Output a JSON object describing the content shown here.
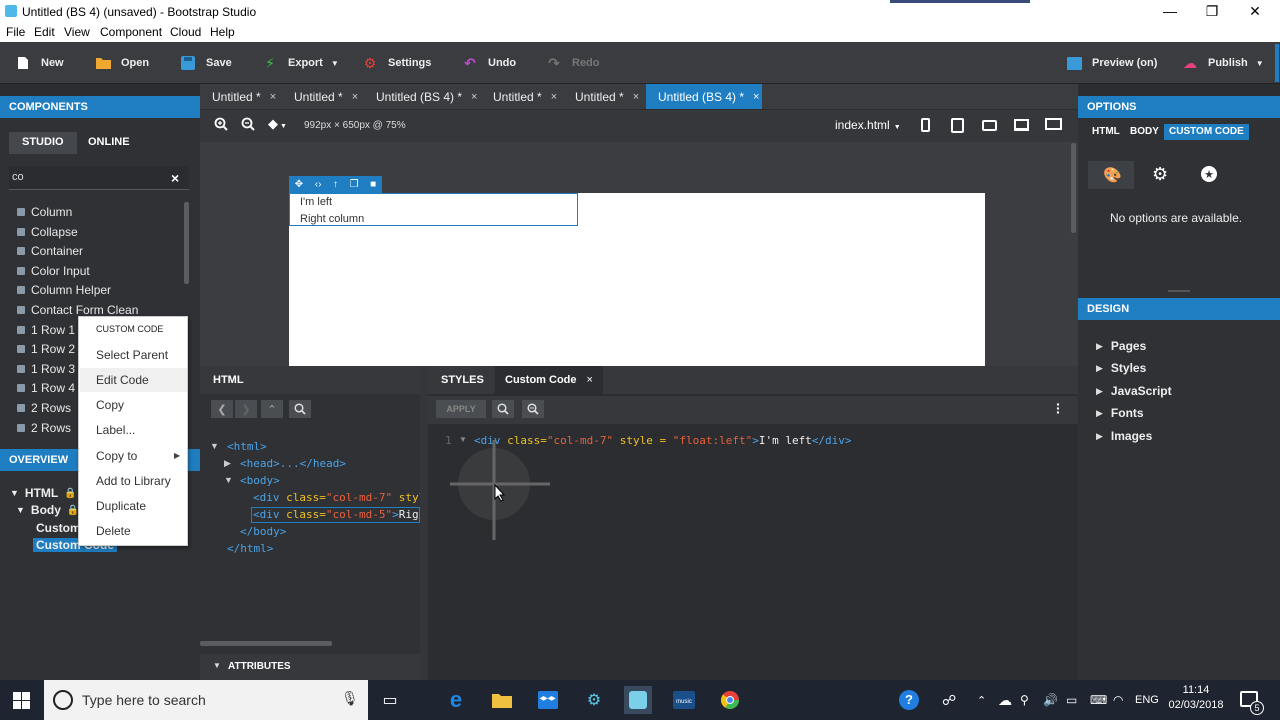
{
  "window": {
    "title": "Untitled (BS 4) (unsaved) - Bootstrap Studio",
    "controls": [
      "—",
      "❐",
      "✕"
    ]
  },
  "menubar": [
    "File",
    "Edit",
    "View",
    "Component",
    "Cloud",
    "Help"
  ],
  "toolbar": {
    "new": "New",
    "open": "Open",
    "save": "Save",
    "export": "Export",
    "settings": "Settings",
    "undo": "Undo",
    "redo": "Redo",
    "preview": "Preview (on)",
    "publish": "Publish"
  },
  "components": {
    "header": "COMPONENTS",
    "tab_studio": "STUDIO",
    "tab_online": "ONLINE",
    "search_value": "co",
    "clear": "×",
    "items": [
      "Column",
      "Collapse",
      "Container",
      "Color Input",
      "Column Helper",
      "Contact Form Clean",
      "1 Row 1",
      "1 Row 2",
      "1 Row 3",
      "1 Row 4",
      "2 Rows",
      "2 Rows"
    ]
  },
  "overview": {
    "header": "OVERVIEW",
    "html": "HTML",
    "body": "Body",
    "child1": "Custom",
    "child2": "Custom Code"
  },
  "doc_tabs": [
    {
      "label": "Untitled *"
    },
    {
      "label": "Untitled *"
    },
    {
      "label": "Untitled (BS 4) *"
    },
    {
      "label": "Untitled *"
    },
    {
      "label": "Untitled *"
    },
    {
      "label": "Untitled (BS 4) *"
    }
  ],
  "canvas_bar": {
    "size": "992px × 650px @ 75%",
    "page": "index.html"
  },
  "canvas": {
    "text1": "I'm left",
    "text2": "Right column"
  },
  "html_panel": {
    "header": "HTML",
    "lines": {
      "html_open": "<html>",
      "head": "<head>...</head>",
      "body_open": "<body>",
      "div1_tag": "<div",
      "div1_attr": "class=",
      "div1_val": "\"col-md-7\"",
      "div1_attr2": "style=",
      "div2_tag": "<div",
      "div2_attr": "class=",
      "div2_val": "\"col-md-5\"",
      "div2_close": ">",
      "div2_text": "Right c",
      "body_close": "</body>",
      "html_close": "</html>"
    },
    "attributes": "ATTRIBUTES"
  },
  "code_panel": {
    "tab_styles": "STYLES",
    "tab_custom": "Custom Code",
    "apply": "APPLY",
    "line_num": "1",
    "code_tag": "<div",
    "code_attr1": "class=",
    "code_val1": "\"col-md-7\"",
    "code_attr2": "style =",
    "code_val2": "\"float:left\"",
    "code_gt": ">",
    "code_text": "I'm left",
    "code_close": "</div>"
  },
  "options": {
    "header": "OPTIONS",
    "tabs": [
      "HTML",
      "BODY",
      "CUSTOM CODE"
    ],
    "empty": "No options are available."
  },
  "design": {
    "header": "DESIGN",
    "items": [
      "Pages",
      "Styles",
      "JavaScript",
      "Fonts",
      "Images"
    ]
  },
  "context_menu": {
    "header": "CUSTOM CODE",
    "items": [
      "Select Parent",
      "Edit Code",
      "Copy",
      "Label...",
      "Copy to",
      "Add to Library",
      "Duplicate",
      "Delete"
    ]
  },
  "taskbar": {
    "search_placeholder": "Type here to search",
    "lang": "ENG",
    "time": "11:14",
    "date": "02/03/2018",
    "notif": "5"
  },
  "colors": {
    "accent": "#1f7ec2",
    "panel": "#2f3135",
    "toolbar": "#3a3c40",
    "code_tag": "#4aa3e8",
    "code_attr": "#f0c020",
    "code_value": "#e8603a"
  }
}
